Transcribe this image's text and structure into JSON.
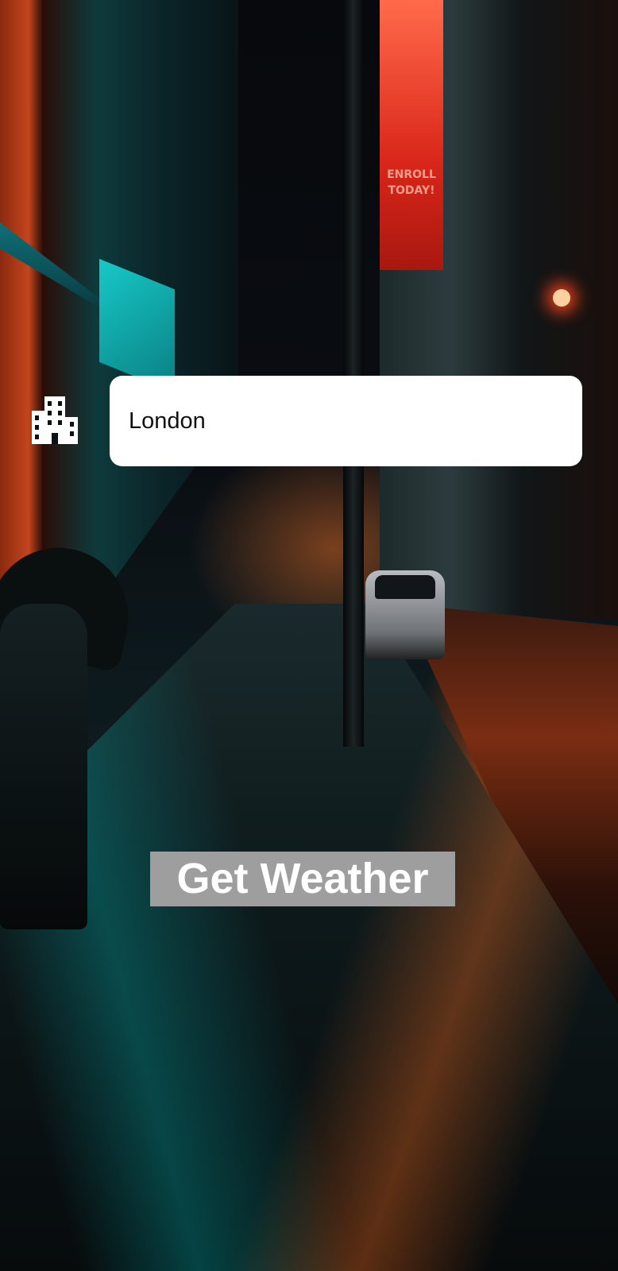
{
  "background": {
    "description_icon": "night-rainy-city-street-photo",
    "banner_text": "ENROLL TODAY!"
  },
  "form": {
    "city_icon": "city-buildings-icon",
    "city_input": {
      "value": "London",
      "placeholder": ""
    },
    "get_weather_label": "Get Weather"
  },
  "colors": {
    "input_background": "#ffffff",
    "button_background": "#9e9e9e",
    "button_text": "#ffffff",
    "icon": "#ffffff"
  }
}
